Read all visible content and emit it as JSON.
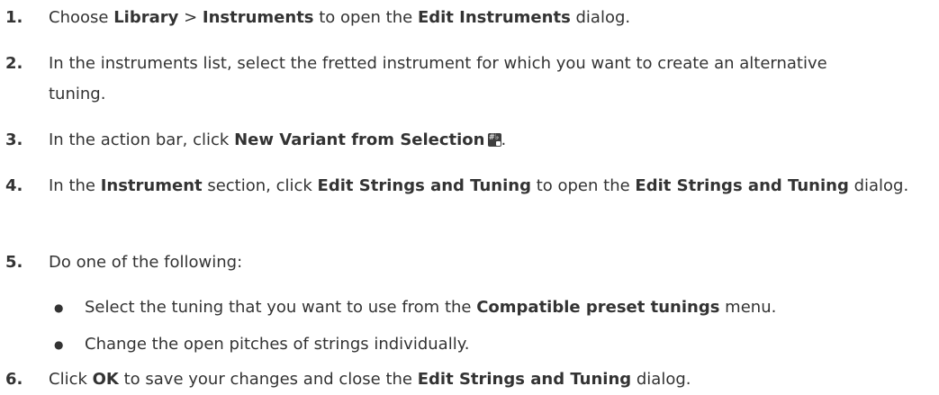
{
  "steps": [
    {
      "num": "1.",
      "parts": [
        "Choose ",
        "Library",
        " > ",
        "Instruments",
        " to open the ",
        "Edit Instruments",
        " dialog."
      ]
    },
    {
      "num": "2.",
      "parts": [
        "In the instruments list, select the fretted instrument for which you want to create an alternative tuning."
      ]
    },
    {
      "num": "3.",
      "parts": [
        "In the action bar, click ",
        "New Variant from Selection",
        "",
        "."
      ]
    },
    {
      "num": "4.",
      "parts": [
        "In the ",
        "Instrument",
        " section, click ",
        "Edit Strings and Tuning",
        " to open the ",
        "Edit Strings and Tuning",
        " dialog."
      ]
    },
    {
      "num": "5.",
      "parts": [
        "Do one of the following:"
      ]
    },
    {
      "num": "6.",
      "parts": [
        "Click ",
        "OK",
        " to save your changes and close the ",
        "Edit Strings and Tuning",
        " dialog."
      ]
    }
  ],
  "bullets": [
    {
      "symbol": "●",
      "parts": [
        "Select the tuning that you want to use from the ",
        "Compatible preset tunings",
        " menu."
      ]
    },
    {
      "symbol": "●",
      "parts": [
        "Change the open pitches of strings individually."
      ]
    }
  ],
  "icons": {
    "new_variant": "new-variant-from-selection-icon"
  }
}
